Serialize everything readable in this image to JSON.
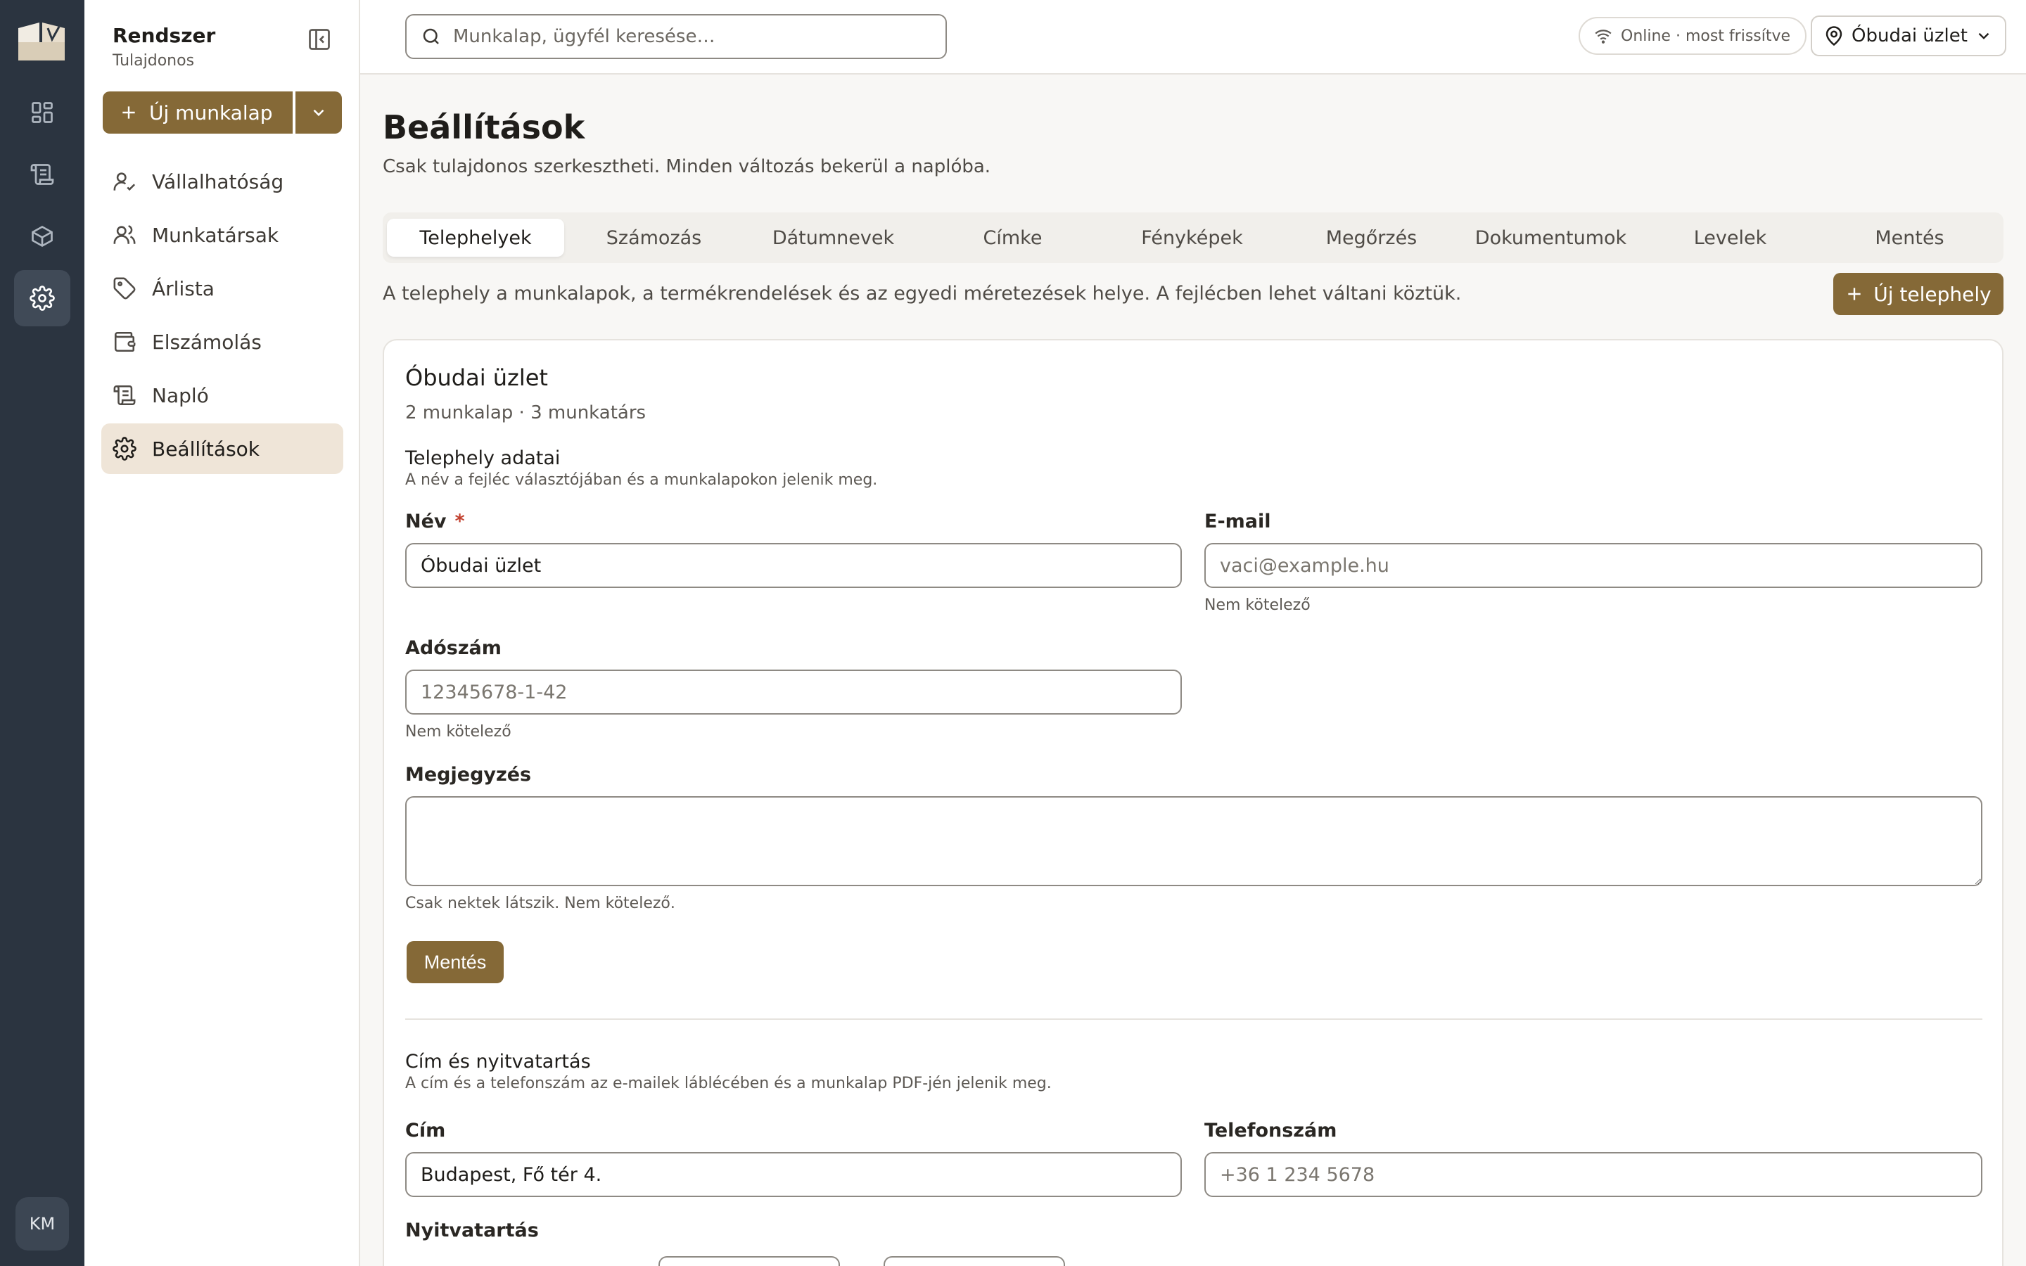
{
  "sidebar": {
    "org_name": "Rendszer",
    "org_role": "Tulajdonos",
    "new_button_label": "Új munkalap",
    "items": [
      {
        "label": "Vállalhatóság",
        "icon": "user-check-icon"
      },
      {
        "label": "Munkatársak",
        "icon": "users-icon"
      },
      {
        "label": "Árlista",
        "icon": "tag-icon"
      },
      {
        "label": "Elszámolás",
        "icon": "wallet-icon"
      },
      {
        "label": "Napló",
        "icon": "scroll-icon"
      },
      {
        "label": "Beállítások",
        "icon": "gear-icon",
        "active": true
      }
    ]
  },
  "rail": {
    "items": [
      "dashboard-icon",
      "scroll-icon",
      "box-icon",
      "gear-icon"
    ],
    "avatar_initials": "KM"
  },
  "topbar": {
    "search_placeholder": "Munkalap, ügyfél keresése…",
    "status_text": "Online · most frissítve",
    "location": "Óbudai üzlet"
  },
  "page": {
    "title": "Beállítások",
    "subtitle": "Csak tulajdonos szerkesztheti. Minden változás bekerül a naplóba."
  },
  "tabs": [
    {
      "label": "Telephelyek",
      "active": true
    },
    {
      "label": "Számozás"
    },
    {
      "label": "Dátumnevek"
    },
    {
      "label": "Címke"
    },
    {
      "label": "Fényképek"
    },
    {
      "label": "Megőrzés"
    },
    {
      "label": "Dokumentumok"
    },
    {
      "label": "Levelek"
    },
    {
      "label": "Mentés"
    }
  ],
  "intro": "A telephely a munkalapok, a termékrendelések és az egyedi méretezések helye. A fejlécben lehet váltani köztük.",
  "new_site_label": "Új telephely",
  "site": {
    "name": "Óbudai üzlet",
    "meta": "2 munkalap · 3 munkatárs",
    "details": {
      "title": "Telephely adatai",
      "desc": "A név a fejléc választójában és a munkalapokon jelenik meg.",
      "name_label": "Név",
      "name_required": "*",
      "name_value": "Óbudai üzlet",
      "email_label": "E-mail",
      "email_placeholder": "vaci@example.hu",
      "email_hint": "Nem kötelező",
      "tax_label": "Adószám",
      "tax_placeholder": "12345678-1-42",
      "tax_hint": "Nem kötelező",
      "note_label": "Megjegyzés",
      "note_value": "",
      "note_hint": "Csak nektek látszik. Nem kötelező.",
      "save_label": "Mentés"
    },
    "address": {
      "title": "Cím és nyitvatartás",
      "desc": "A cím és a telefonszám az e-mailek láblécében és a munkalap PDF-jén jelenik meg.",
      "address_label": "Cím",
      "address_value": "Budapest, Fő tér 4.",
      "phone_label": "Telefonszám",
      "phone_placeholder": "+36 1 234 5678",
      "hours_label": "Nyitvatartás"
    }
  },
  "colors": {
    "accent": "#856937",
    "rail": "#2b3440",
    "active_nav": "#efe5d8",
    "required": "#c2402e"
  }
}
